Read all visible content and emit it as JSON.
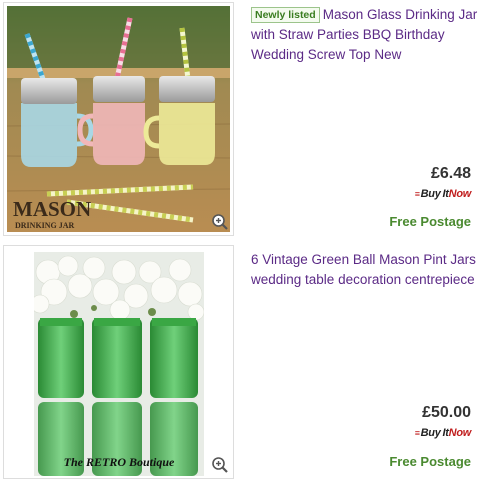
{
  "listings": [
    {
      "badge": "Newly listed",
      "title": "Mason Glass Drinking Jar with Straw Parties BBQ Birthday Wedding Screw Top New",
      "price": "£6.48",
      "buy_it": "Buy",
      "buy_it_mid": "It",
      "buy_it_now": "Now",
      "shipping": "Free Postage",
      "image_text_line1": "MASON",
      "image_text_line2": "DRINKING JAR",
      "zoom_icon": "magnifier-plus-icon"
    },
    {
      "title": "6 Vintage Green Ball Mason Pint Jars wedding table decoration centrepiece",
      "price": "£50.00",
      "buy_it": "Buy",
      "buy_it_mid": "It",
      "buy_it_now": "Now",
      "shipping": "Free Postage",
      "image_text_line1": "The RETRO Boutique",
      "zoom_icon": "magnifier-plus-icon"
    }
  ]
}
